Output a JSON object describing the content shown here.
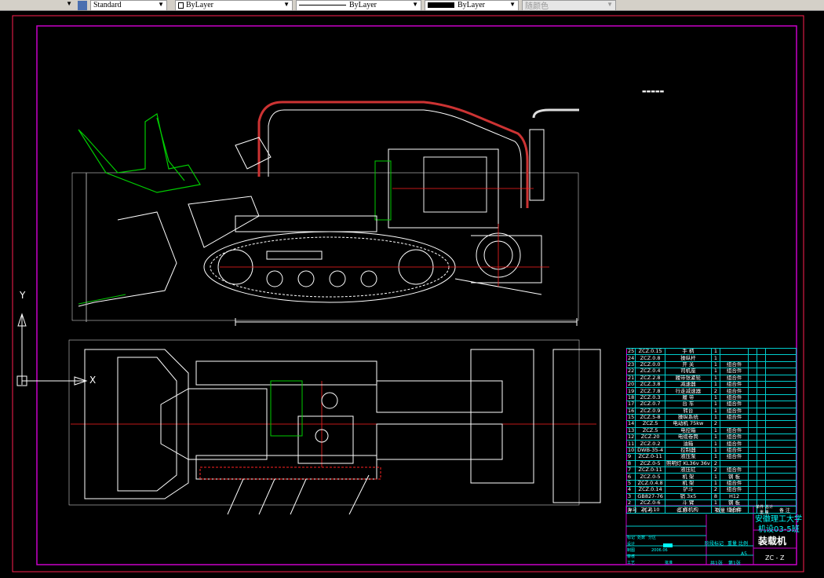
{
  "toolbar": {
    "text_style": "Standard",
    "layer": "ByLayer",
    "linetype": "ByLayer",
    "lineweight": "ByLayer",
    "plot_style": "随颜色"
  },
  "ucs": {
    "y_label": "Y",
    "x_label": "X"
  },
  "colors": {
    "border": "#c800c8",
    "frame": "#ff0000",
    "grid": "#00cccc",
    "machine": "#ffffff",
    "bucket": "#00cc00",
    "centerline": "#ff2020"
  },
  "parts_list": {
    "rows": [
      {
        "no": "25",
        "code": "ZCZ.0.15",
        "name": "手 柄",
        "qty": "1",
        "material": ""
      },
      {
        "no": "24",
        "code": "ZCZ.0.8",
        "name": "操纵杆",
        "qty": "1",
        "material": ""
      },
      {
        "no": "23",
        "code": "ZCZ.0.0",
        "name": "开 关",
        "qty": "1",
        "material": "组合件"
      },
      {
        "no": "22",
        "code": "ZCZ.0.4",
        "name": "司机座",
        "qty": "1",
        "material": "组合件"
      },
      {
        "no": "21",
        "code": "ZCZ.2.8",
        "name": "履带张紧轮",
        "qty": "1",
        "material": "组合件"
      },
      {
        "no": "20",
        "code": "ZCZ.3.8",
        "name": "减速器",
        "qty": "1",
        "material": "组合件"
      },
      {
        "no": "19",
        "code": "ZCZ.7.8",
        "name": "行走减速器",
        "qty": "2",
        "material": "组合件"
      },
      {
        "no": "18",
        "code": "ZCZ.0.3",
        "name": "履 带",
        "qty": "1",
        "material": "组合件"
      },
      {
        "no": "17",
        "code": "ZCZ.0.7",
        "name": "台 车",
        "qty": "1",
        "material": "组合件"
      },
      {
        "no": "16",
        "code": "ZCZ.0.9",
        "name": "转台",
        "qty": "1",
        "material": "组合件"
      },
      {
        "no": "15",
        "code": "ZCZ.5-8",
        "name": "操纵系统",
        "qty": "1",
        "material": "组合件"
      },
      {
        "no": "14",
        "code": "ZCZ.5",
        "name": "电动机 75kw",
        "qty": "2",
        "material": ""
      },
      {
        "no": "13",
        "code": "ZCZ.5",
        "name": "电控箱",
        "qty": "1",
        "material": "组合件"
      },
      {
        "no": "12",
        "code": "ZCZ.20",
        "name": "电缆卷筒",
        "qty": "1",
        "material": "组合件"
      },
      {
        "no": "11",
        "code": "ZCZ.0.2",
        "name": "油箱",
        "qty": "1",
        "material": "组合件"
      },
      {
        "no": "10",
        "code": "DWB-35-4",
        "name": "控制器",
        "qty": "1",
        "material": "组合件"
      },
      {
        "no": "9",
        "code": "ZCZ.0-11",
        "name": "液压泵",
        "qty": "1",
        "material": "组合件"
      },
      {
        "no": "8",
        "code": "ZCZ.0-5",
        "name": "照明灯 KL36v 36v",
        "qty": "2",
        "material": ""
      },
      {
        "no": "7",
        "code": "ZCZ.0-11",
        "name": "液压缸",
        "qty": "2",
        "material": "组合件"
      },
      {
        "no": "6",
        "code": "ZCZ.0-5",
        "name": "机 架",
        "qty": "1",
        "material": "钢 板"
      },
      {
        "no": "5",
        "code": "ZCZ.0.4.8",
        "name": "机 架",
        "qty": "1",
        "material": "组合件"
      },
      {
        "no": "4",
        "code": "ZCZ.0.14",
        "name": "铲斗",
        "qty": "2",
        "material": "组合件"
      },
      {
        "no": "3",
        "code": "GB827-76",
        "name": "销 3x5",
        "qty": "8",
        "material": "H12"
      },
      {
        "no": "2",
        "code": "ZCZ.0-6",
        "name": "斗 臂",
        "qty": "1",
        "material": "钢 板"
      },
      {
        "no": "1",
        "code": "ZCZ.10",
        "name": "工作机构",
        "qty": "1",
        "material": "组合件"
      }
    ],
    "header": {
      "no": "序号",
      "code": "代 号",
      "name": "名 称",
      "qty": "数量",
      "material": "材 料",
      "unit_weight": "单件",
      "total_weight": "总计",
      "weight": "重 量",
      "remark": "备 注"
    }
  },
  "title_block": {
    "school": "安徽理工大学",
    "class": "机设03-5班",
    "drawing_title": "装载机",
    "drawing_no": "ZC - Z",
    "scale": "A5",
    "stage_mark": "阶段标记",
    "weight": "重量",
    "ratio": "比例",
    "sheets_total": "共1张",
    "sheet_no": "第1张",
    "labels": {
      "mark": "标记",
      "count": "处数",
      "zone": "分区",
      "design": "设计",
      "drafter": "制图",
      "check": "审核",
      "process": "工艺",
      "approve": "批准",
      "date_value": "2006.06"
    }
  }
}
